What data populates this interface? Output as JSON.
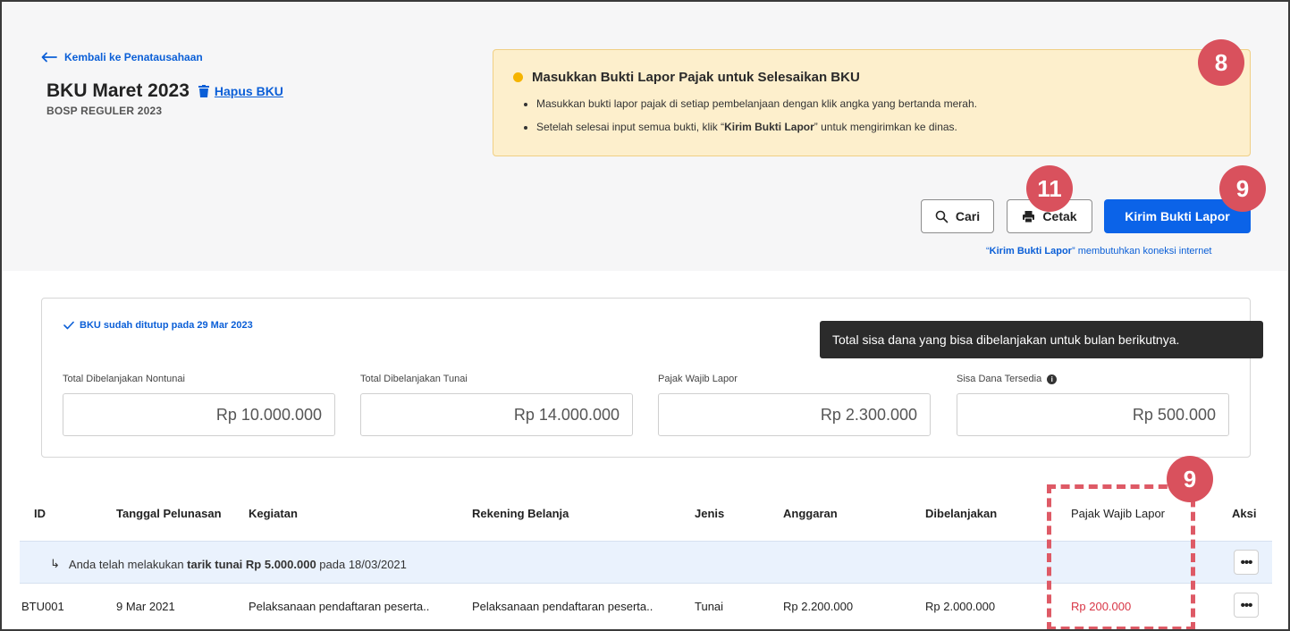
{
  "header": {
    "back_label": "Kembali ke Penatausahaan",
    "title": "BKU Maret 2023",
    "delete_label": "Hapus BKU",
    "subtitle": "BOSP REGULER 2023"
  },
  "alert": {
    "title": "Masukkan Bukti Lapor Pajak untuk Selesaikan BKU",
    "item1": "Masukkan bukti lapor pajak di setiap pembelanjaan dengan klik angka yang bertanda merah.",
    "item2_pre": "Setelah selesai input semua bukti, klik “",
    "item2_bold": "Kirim Bukti Lapor",
    "item2_post": "” untuk mengirimkan ke dinas."
  },
  "badges": {
    "alert": "8",
    "print": "11",
    "send": "9",
    "column": "9"
  },
  "actions": {
    "search_label": "Cari",
    "print_label": "Cetak",
    "send_label": "Kirim Bukti Lapor",
    "note_open_quote": "“",
    "note_bold": "Kirim Bukti Lapor",
    "note_rest": "” membutuhkan koneksi internet"
  },
  "summary": {
    "closed_note": "BKU sudah ditutup pada 29 Mar 2023",
    "tooltip": "Total sisa dana yang bisa dibelanjakan untuk bulan berikutnya.",
    "metrics": [
      {
        "label": "Total Dibelanjakan Nontunai",
        "value": "Rp 10.000.000"
      },
      {
        "label": "Total Dibelanjakan Tunai",
        "value": "Rp 14.000.000"
      },
      {
        "label": "Pajak Wajib Lapor",
        "value": "Rp 2.300.000"
      },
      {
        "label": "Sisa Dana Tersedia",
        "value": "Rp 500.000",
        "info": "i"
      }
    ]
  },
  "table": {
    "headers": [
      "ID",
      "Tanggal Pelunasan",
      "Kegiatan",
      "Rekening Belanja",
      "Jenis",
      "Anggaran",
      "Dibelanjakan",
      "Pajak Wajib Lapor",
      "Aksi"
    ],
    "tarik_pre": "Anda telah melakukan ",
    "tarik_bold": "tarik tunai Rp 5.000.000",
    "tarik_post": " pada 18/03/2021",
    "rows": [
      {
        "id": "BTU001",
        "tanggal": "9 Mar 2021",
        "kegiatan": "Pelaksanaan pendaftaran peserta..",
        "rekening": "Pelaksanaan pendaftaran peserta..",
        "jenis": "Tunai",
        "anggaran": "Rp 2.200.000",
        "dibelanjakan": "Rp 2.000.000",
        "pajak": "Rp 200.000"
      }
    ],
    "more_label": "•••"
  },
  "colors": {
    "accent": "#0b63e8",
    "badge": "#d9515d",
    "warning_bg": "#fdefcc",
    "negative": "#d83545"
  }
}
